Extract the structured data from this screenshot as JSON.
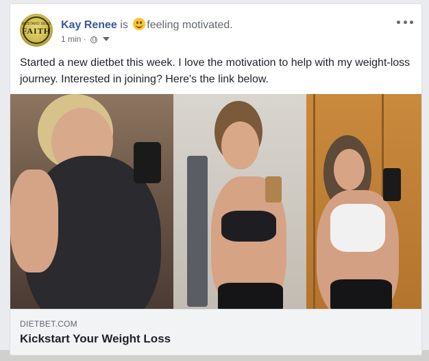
{
  "post": {
    "author": "Kay Renee",
    "is_word": "is",
    "feeling_icon": "smiley-emoji-icon",
    "feeling": "feeling motivated.",
    "time": "1 min",
    "separator": "·",
    "privacy_icon": "globe-icon",
    "text": "Started a new dietbet this week. I love the motivation to help with my weight-loss journey. Interested in joining? Here's the link below."
  },
  "avatar": {
    "small_text": "MUSTARD SEED",
    "big_text": "FAITH"
  },
  "link_preview": {
    "domain": "DIETBET.COM",
    "title": "Kickstart Your Weight Loss"
  },
  "colors": {
    "author_blue": "#365899",
    "text": "#1d2129",
    "secondary": "#616770",
    "preview_bg": "#f2f3f5"
  }
}
